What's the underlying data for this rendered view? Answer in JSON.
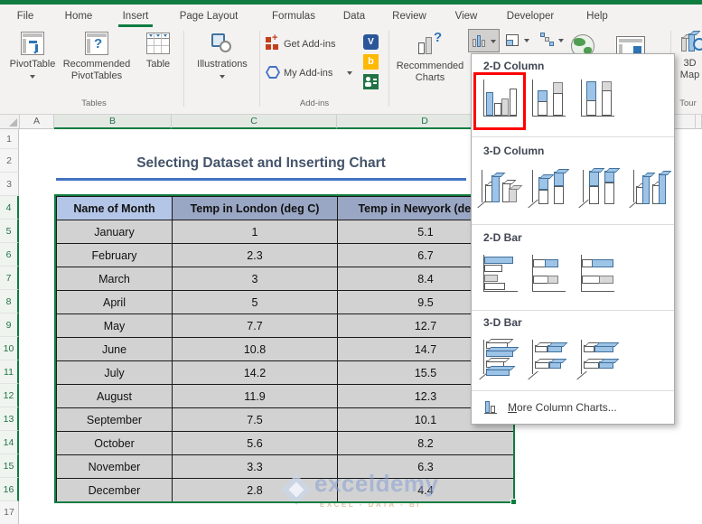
{
  "ribbon": {
    "tabs": [
      "File",
      "Home",
      "Insert",
      "Page Layout",
      "Formulas",
      "Data",
      "Review",
      "View",
      "Developer",
      "Help"
    ],
    "active_tab": "Insert",
    "groups": {
      "tables": {
        "label": "Tables",
        "pivottable": "PivotTable",
        "recommended_pivottables": "Recommended PivotTables",
        "table": "Table"
      },
      "illustrations": {
        "button": "Illustrations"
      },
      "addins": {
        "label": "Add-ins",
        "get_addins": "Get Add-ins",
        "my_addins": "My Add-ins"
      },
      "charts": {
        "recommended_charts": "Recommended Charts"
      },
      "tour": {
        "label": "Tour",
        "map_3d": "3D Map"
      }
    }
  },
  "chart_dropdown": {
    "sections": [
      {
        "title": "2-D Column"
      },
      {
        "title": "3-D Column"
      },
      {
        "title": "2-D Bar"
      },
      {
        "title": "3-D Bar"
      }
    ],
    "footer": {
      "accelerator": "M",
      "rest": "ore Column Charts..."
    },
    "highlighted_item": "Clustered Column"
  },
  "sheet": {
    "column_headers": [
      "A",
      "B",
      "C",
      "D"
    ],
    "row_numbers": [
      "1",
      "2",
      "3",
      "4",
      "5",
      "6",
      "7",
      "8",
      "9",
      "10",
      "11",
      "12",
      "13",
      "14",
      "15",
      "16",
      "17"
    ],
    "title": "Selecting Dataset and Inserting Chart",
    "table": {
      "headers": [
        "Name of Month",
        "Temp in London (deg C)",
        "Temp in Newyork (deg C)"
      ],
      "rows": [
        [
          "January",
          "1",
          "5.1"
        ],
        [
          "February",
          "2.3",
          "6.7"
        ],
        [
          "March",
          "3",
          "8.4"
        ],
        [
          "April",
          "5",
          "9.5"
        ],
        [
          "May",
          "7.7",
          "12.7"
        ],
        [
          "June",
          "10.8",
          "14.7"
        ],
        [
          "July",
          "14.2",
          "15.5"
        ],
        [
          "August",
          "11.9",
          "12.3"
        ],
        [
          "September",
          "7.5",
          "10.1"
        ],
        [
          "October",
          "5.6",
          "8.2"
        ],
        [
          "November",
          "3.3",
          "6.3"
        ],
        [
          "December",
          "2.8",
          "4.4"
        ]
      ]
    },
    "watermark": {
      "name": "exceldemy",
      "tagline": "EXCEL - DATA - BI"
    }
  },
  "colors": {
    "excel_green": "#107C41",
    "selection_border": "#107C41",
    "active_cell_fill": "#B4C6E7",
    "header_fill_selected": "#9AA7C4",
    "cell_fill_selected": "#D2D2D2",
    "title_text": "#44546A",
    "accent_line": "#4472C4",
    "gallery_blue": "#9DC3E6",
    "gallery_gray": "#D9D9D9",
    "highlight_red": "#FF0000"
  }
}
